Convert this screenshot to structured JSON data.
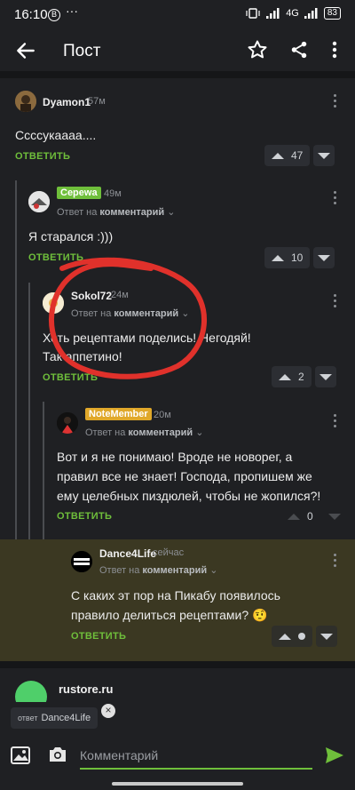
{
  "status_bar": {
    "time": "16:10",
    "b_badge": "B",
    "dots": "···",
    "network": "4G",
    "battery": "83"
  },
  "app_bar": {
    "title": "Пост"
  },
  "comments": [
    {
      "user": "Dyamon1",
      "time": "57м",
      "text": "Ссссукаааа....",
      "reply": "ОТВЕТИТЬ",
      "votes": "47"
    },
    {
      "user": "Серewa",
      "time": "49м",
      "reply_to_prefix": "Ответ на",
      "reply_to_target": "комментарий",
      "text": "Я старался :)))",
      "reply": "ОТВЕТИТЬ",
      "votes": "10"
    },
    {
      "user": "Sokol72",
      "time": "24м",
      "reply_to_prefix": "Ответ на",
      "reply_to_target": "комментарий",
      "text_line1": "Хоть рецептами поделись! Негодяй!",
      "text_line2": "Так аппетино!",
      "reply": "ОТВЕТИТЬ",
      "votes": "2"
    },
    {
      "user": "NoteMember",
      "time": "20м",
      "reply_to_prefix": "Ответ на",
      "reply_to_target": "комментарий",
      "text_line1": "Вот и я не понимаю! Вроде не новорег, а",
      "text_line2": "правил все не знает! Господа, пропишем же",
      "text_line3": "ему целебных пиздюлей, чтобы не жопился?!",
      "reply": "ОТВЕТИТЬ",
      "votes": "0"
    },
    {
      "user": "Dance4Life",
      "time": "сейчас",
      "reply_to_prefix": "Ответ на",
      "reply_to_target": "комментарий",
      "text_line1": "С каких эт пор на Пикабу появилось",
      "text_line2": "правило делиться рецептами? 🤨",
      "reply": "ОТВЕТИТЬ"
    }
  ],
  "ad": {
    "domain": "rustore.ru"
  },
  "composer": {
    "chip_prefix": "ответ",
    "chip_user": "Dance4Life",
    "placeholder": "Комментарий"
  },
  "colors": {
    "accent": "#6fbf3b",
    "annotation": "#e0312b",
    "highlight_bg": "#3b3822"
  }
}
